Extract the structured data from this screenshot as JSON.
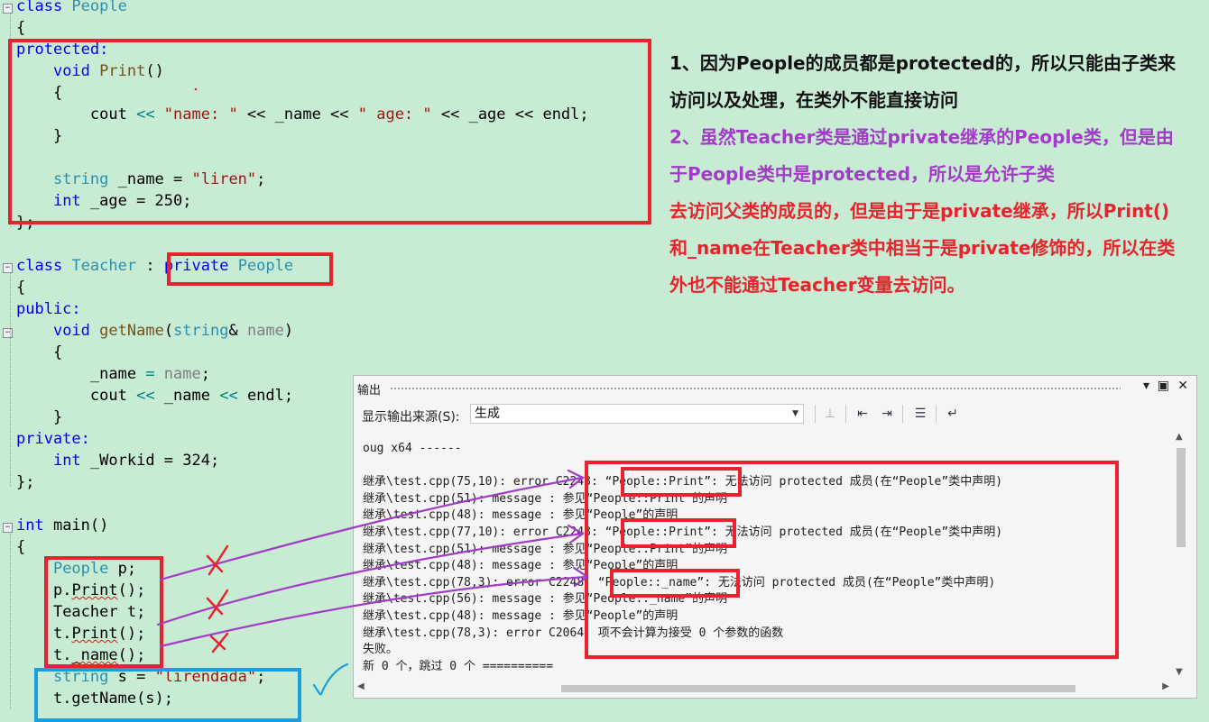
{
  "code": {
    "class_people": [
      "class",
      " People"
    ],
    "brace_open": "{",
    "protected_label": "protected:",
    "print_decl": [
      "void",
      "Print",
      "()"
    ],
    "cout_line": [
      "cout",
      " << ",
      "\"name: \"",
      " << _name << ",
      "\" age: \"",
      " << _age << endl;"
    ],
    "close_brace": "}",
    "name_decl": [
      "string",
      " _name = ",
      "\"liren\"",
      ";"
    ],
    "age_decl": [
      "int",
      " _age = 250;"
    ],
    "class_end": "};",
    "class_teacher": [
      "class",
      " Teacher",
      " :"
    ],
    "private_people": [
      "private",
      " People"
    ],
    "public_label": "public:",
    "getname_decl": [
      "void",
      "getName",
      "(",
      "string",
      "&",
      " name",
      ")"
    ],
    "assign_line": [
      "_name",
      " = ",
      "name",
      ";"
    ],
    "cout2_line": [
      "cout",
      " << ",
      "_name",
      " << ",
      "endl",
      ";"
    ],
    "private_label": "private:",
    "workid_decl": [
      "int",
      " _Workid = 324;"
    ],
    "main_decl": [
      "int",
      " main()"
    ],
    "people_p": [
      "People",
      " p;"
    ],
    "p_print": [
      "p.",
      "Print",
      "();"
    ],
    "teacher_t": [
      "Teacher",
      " t;"
    ],
    "t_print": [
      "t.",
      "Print",
      "();"
    ],
    "t_name": [
      "t.",
      "_name",
      "();"
    ],
    "string_s": [
      "string",
      " s = ",
      "\"lirendada\"",
      ";"
    ],
    "t_getname": "t.getName(s);"
  },
  "annotation": {
    "note1": "1、因为People的成员都是protected的，所以只能由子类来访问以及处理，在类外不能直接访问",
    "note2": "2、虽然Teacher类是通过private继承的People类，但是由于People类中是protected，所以是允许子类",
    "note3": "去访问父类的成员的，但是由于是private继承，所以Print()和_name在Teacher类中相当于是private修饰的，所以在类外也不能通过Teacher变量去访问。",
    "cross_mark": "X",
    "check_mark": "✓"
  },
  "output_panel": {
    "title": "输出",
    "source_label": "显示输出来源(S):",
    "source_value": "生成",
    "controls": {
      "dropdown": "▾",
      "maximize": "▣",
      "close": "✕"
    },
    "lines": [
      "oug x64 ------",
      "",
      "继承\\test.cpp(75,10): error C2248: “People::Print”: 无法访问 protected 成员(在“People”类中声明)",
      "继承\\test.cpp(51): message : 参见“People::Print”的声明",
      "继承\\test.cpp(48): message : 参见“People”的声明",
      "继承\\test.cpp(77,10): error C2248: “People::Print”: 无法访问 protected 成员(在“People”类中声明)",
      "继承\\test.cpp(51): message : 参见“People::Print”的声明",
      "继承\\test.cpp(48): message : 参见“People”的声明",
      "继承\\test.cpp(78,3): error C2248: “People::_name”: 无法访问 protected 成员(在“People”类中声明)",
      "继承\\test.cpp(56): message : 参见“People::_name”的声明",
      "继承\\test.cpp(48): message : 参见“People”的声明",
      "继承\\test.cpp(78,3): error C2064: 项不会计算为接受 0 个参数的函数",
      "失败。",
      "新 0 个，跳过 0 个 =========="
    ]
  },
  "colors": {
    "background": "#c7ebd3",
    "keyword": "#0000ff",
    "type": "#2b91af",
    "function": "#74531f",
    "string": "#a31515",
    "highlight_box": "#e8232d",
    "blue_box": "#1a9ee0",
    "arrow": "#a23cc8"
  }
}
